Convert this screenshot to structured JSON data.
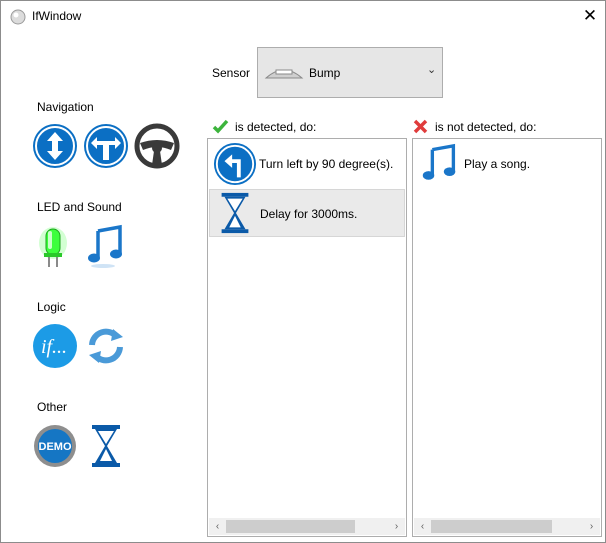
{
  "window": {
    "title": "IfWindow"
  },
  "palette": {
    "navigation": {
      "heading": "Navigation",
      "icons": [
        "up-down-arrow-icon",
        "fork-arrow-icon",
        "steering-wheel-icon"
      ]
    },
    "led_sound": {
      "heading": "LED and Sound",
      "icons": [
        "green-led-icon",
        "music-note-icon"
      ]
    },
    "logic": {
      "heading": "Logic",
      "icons": [
        "if-icon",
        "loop-icon"
      ]
    },
    "other": {
      "heading": "Other",
      "icons": [
        "demo-icon",
        "hourglass-icon"
      ]
    }
  },
  "sensor": {
    "label": "Sensor",
    "selected": "Bump",
    "icon": "bump-sensor-icon"
  },
  "detected": {
    "header": "is detected, do:",
    "header_icon": "checkmark-icon",
    "items": [
      {
        "icon": "turn-left-icon",
        "text": "Turn left by 90 degree(s)."
      },
      {
        "icon": "hourglass-icon",
        "text": "Delay for 3000ms."
      }
    ]
  },
  "not_detected": {
    "header": "is not detected, do:",
    "header_icon": "x-mark-icon",
    "items": [
      {
        "icon": "music-note-icon",
        "text": "Play a song."
      }
    ]
  },
  "colors": {
    "accent_blue": "#0b6fc4",
    "check_green": "#3cb43c",
    "x_red": "#e03c3c",
    "led_green": "#3cff3c"
  }
}
